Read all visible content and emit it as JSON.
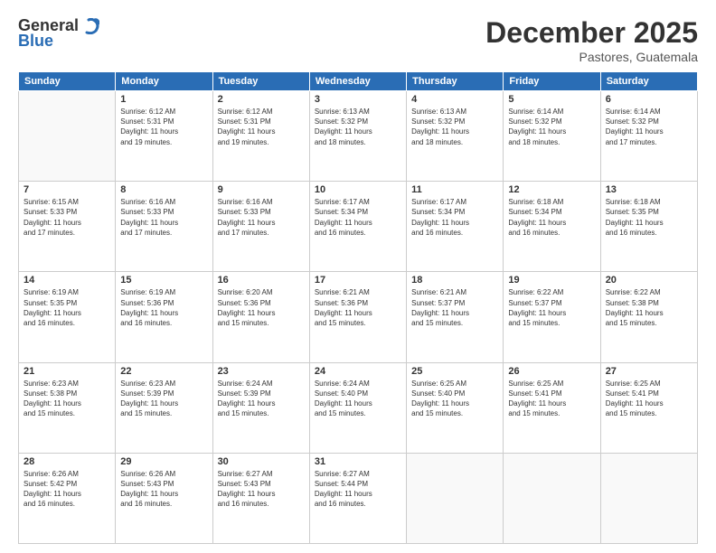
{
  "header": {
    "logo_general": "General",
    "logo_blue": "Blue",
    "month_title": "December 2025",
    "location": "Pastores, Guatemala"
  },
  "weekdays": [
    "Sunday",
    "Monday",
    "Tuesday",
    "Wednesday",
    "Thursday",
    "Friday",
    "Saturday"
  ],
  "weeks": [
    [
      {
        "day": "",
        "info": ""
      },
      {
        "day": "1",
        "info": "Sunrise: 6:12 AM\nSunset: 5:31 PM\nDaylight: 11 hours\nand 19 minutes."
      },
      {
        "day": "2",
        "info": "Sunrise: 6:12 AM\nSunset: 5:31 PM\nDaylight: 11 hours\nand 19 minutes."
      },
      {
        "day": "3",
        "info": "Sunrise: 6:13 AM\nSunset: 5:32 PM\nDaylight: 11 hours\nand 18 minutes."
      },
      {
        "day": "4",
        "info": "Sunrise: 6:13 AM\nSunset: 5:32 PM\nDaylight: 11 hours\nand 18 minutes."
      },
      {
        "day": "5",
        "info": "Sunrise: 6:14 AM\nSunset: 5:32 PM\nDaylight: 11 hours\nand 18 minutes."
      },
      {
        "day": "6",
        "info": "Sunrise: 6:14 AM\nSunset: 5:32 PM\nDaylight: 11 hours\nand 17 minutes."
      }
    ],
    [
      {
        "day": "7",
        "info": "Sunrise: 6:15 AM\nSunset: 5:33 PM\nDaylight: 11 hours\nand 17 minutes."
      },
      {
        "day": "8",
        "info": "Sunrise: 6:16 AM\nSunset: 5:33 PM\nDaylight: 11 hours\nand 17 minutes."
      },
      {
        "day": "9",
        "info": "Sunrise: 6:16 AM\nSunset: 5:33 PM\nDaylight: 11 hours\nand 17 minutes."
      },
      {
        "day": "10",
        "info": "Sunrise: 6:17 AM\nSunset: 5:34 PM\nDaylight: 11 hours\nand 16 minutes."
      },
      {
        "day": "11",
        "info": "Sunrise: 6:17 AM\nSunset: 5:34 PM\nDaylight: 11 hours\nand 16 minutes."
      },
      {
        "day": "12",
        "info": "Sunrise: 6:18 AM\nSunset: 5:34 PM\nDaylight: 11 hours\nand 16 minutes."
      },
      {
        "day": "13",
        "info": "Sunrise: 6:18 AM\nSunset: 5:35 PM\nDaylight: 11 hours\nand 16 minutes."
      }
    ],
    [
      {
        "day": "14",
        "info": "Sunrise: 6:19 AM\nSunset: 5:35 PM\nDaylight: 11 hours\nand 16 minutes."
      },
      {
        "day": "15",
        "info": "Sunrise: 6:19 AM\nSunset: 5:36 PM\nDaylight: 11 hours\nand 16 minutes."
      },
      {
        "day": "16",
        "info": "Sunrise: 6:20 AM\nSunset: 5:36 PM\nDaylight: 11 hours\nand 15 minutes."
      },
      {
        "day": "17",
        "info": "Sunrise: 6:21 AM\nSunset: 5:36 PM\nDaylight: 11 hours\nand 15 minutes."
      },
      {
        "day": "18",
        "info": "Sunrise: 6:21 AM\nSunset: 5:37 PM\nDaylight: 11 hours\nand 15 minutes."
      },
      {
        "day": "19",
        "info": "Sunrise: 6:22 AM\nSunset: 5:37 PM\nDaylight: 11 hours\nand 15 minutes."
      },
      {
        "day": "20",
        "info": "Sunrise: 6:22 AM\nSunset: 5:38 PM\nDaylight: 11 hours\nand 15 minutes."
      }
    ],
    [
      {
        "day": "21",
        "info": "Sunrise: 6:23 AM\nSunset: 5:38 PM\nDaylight: 11 hours\nand 15 minutes."
      },
      {
        "day": "22",
        "info": "Sunrise: 6:23 AM\nSunset: 5:39 PM\nDaylight: 11 hours\nand 15 minutes."
      },
      {
        "day": "23",
        "info": "Sunrise: 6:24 AM\nSunset: 5:39 PM\nDaylight: 11 hours\nand 15 minutes."
      },
      {
        "day": "24",
        "info": "Sunrise: 6:24 AM\nSunset: 5:40 PM\nDaylight: 11 hours\nand 15 minutes."
      },
      {
        "day": "25",
        "info": "Sunrise: 6:25 AM\nSunset: 5:40 PM\nDaylight: 11 hours\nand 15 minutes."
      },
      {
        "day": "26",
        "info": "Sunrise: 6:25 AM\nSunset: 5:41 PM\nDaylight: 11 hours\nand 15 minutes."
      },
      {
        "day": "27",
        "info": "Sunrise: 6:25 AM\nSunset: 5:41 PM\nDaylight: 11 hours\nand 15 minutes."
      }
    ],
    [
      {
        "day": "28",
        "info": "Sunrise: 6:26 AM\nSunset: 5:42 PM\nDaylight: 11 hours\nand 16 minutes."
      },
      {
        "day": "29",
        "info": "Sunrise: 6:26 AM\nSunset: 5:43 PM\nDaylight: 11 hours\nand 16 minutes."
      },
      {
        "day": "30",
        "info": "Sunrise: 6:27 AM\nSunset: 5:43 PM\nDaylight: 11 hours\nand 16 minutes."
      },
      {
        "day": "31",
        "info": "Sunrise: 6:27 AM\nSunset: 5:44 PM\nDaylight: 11 hours\nand 16 minutes."
      },
      {
        "day": "",
        "info": ""
      },
      {
        "day": "",
        "info": ""
      },
      {
        "day": "",
        "info": ""
      }
    ]
  ]
}
